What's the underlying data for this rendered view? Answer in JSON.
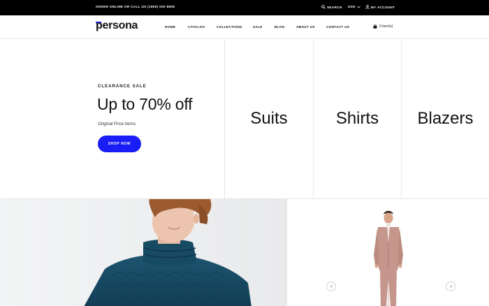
{
  "topbar": {
    "order_text": "ORDER ONLINE OR CALL US (1800) 000 8808",
    "search_label": "SEARCH",
    "currency_label": "USD",
    "account_label": "MY ACCOUNT"
  },
  "header": {
    "logo_text": "persona",
    "nav": [
      "HOME",
      "CATALOG",
      "COLLECTIONS",
      "SALE",
      "BLOG",
      "ABOUT US",
      "CONTACT US"
    ],
    "cart_label": "0 item(s)"
  },
  "hero": {
    "kicker": "CLEARANCE SALE",
    "headline": "Up to 70% off",
    "subtext": "Original Price Items.",
    "button_label": "SHOP NOW"
  },
  "categories": [
    "Suits",
    "Shirts",
    "Blazers"
  ],
  "colors": {
    "accent": "#1a1df5",
    "topbar_bg": "#000000",
    "border": "#e6e6e6"
  }
}
